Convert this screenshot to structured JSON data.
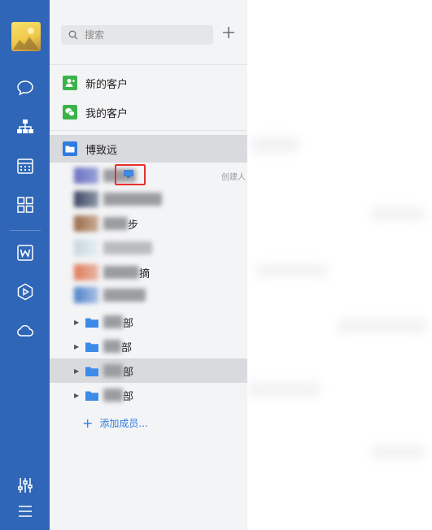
{
  "app": {
    "accent_color": "#2f66b7"
  },
  "rail": {
    "items": [
      {
        "icon": "chat-bubble-icon"
      },
      {
        "icon": "org-chart-icon",
        "active": true
      },
      {
        "icon": "calendar-icon"
      },
      {
        "icon": "apps-grid-icon"
      },
      {
        "icon": "word-doc-icon"
      },
      {
        "icon": "hexagon-play-icon"
      },
      {
        "icon": "cloud-icon"
      }
    ],
    "bottom": [
      {
        "icon": "sliders-icon"
      },
      {
        "icon": "menu-icon"
      }
    ]
  },
  "search": {
    "placeholder": "搜索"
  },
  "quick": {
    "new_customers": "新的客户",
    "my_customers": "我的客户"
  },
  "org": {
    "name": "博致远",
    "creator_tag": "创建人",
    "members": [
      {
        "name": "",
        "badge": "pc-icon"
      },
      {
        "name": ""
      },
      {
        "name": "步"
      },
      {
        "name": ""
      },
      {
        "name": "摘"
      },
      {
        "name": ""
      }
    ],
    "departments": [
      {
        "label": "部"
      },
      {
        "label": "部"
      },
      {
        "label": "部",
        "selected": true
      },
      {
        "label": "部"
      }
    ],
    "add_member": "添加成员..."
  }
}
